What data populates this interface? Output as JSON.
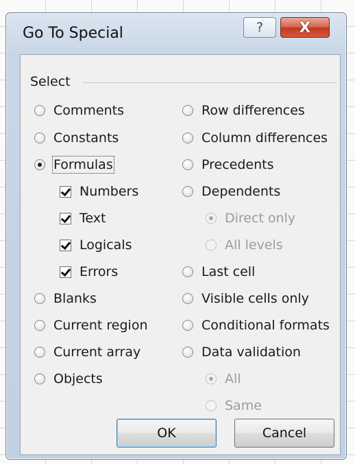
{
  "window": {
    "title": "Go To Special",
    "help_icon": "?",
    "close_icon": "X"
  },
  "group": {
    "label": "Select"
  },
  "left_options": [
    {
      "label": "Comments",
      "type": "radio",
      "selected": false,
      "enabled": true
    },
    {
      "label": "Constants",
      "type": "radio",
      "selected": false,
      "enabled": true
    },
    {
      "label": "Formulas",
      "type": "radio",
      "selected": true,
      "enabled": true
    },
    {
      "label": "Numbers",
      "type": "checkbox",
      "checked": true,
      "enabled": true
    },
    {
      "label": "Text",
      "type": "checkbox",
      "checked": true,
      "enabled": true
    },
    {
      "label": "Logicals",
      "type": "checkbox",
      "checked": true,
      "enabled": true
    },
    {
      "label": "Errors",
      "type": "checkbox",
      "checked": true,
      "enabled": true
    },
    {
      "label": "Blanks",
      "type": "radio",
      "selected": false,
      "enabled": true
    },
    {
      "label": "Current region",
      "type": "radio",
      "selected": false,
      "enabled": true
    },
    {
      "label": "Current array",
      "type": "radio",
      "selected": false,
      "enabled": true
    },
    {
      "label": "Objects",
      "type": "radio",
      "selected": false,
      "enabled": true
    }
  ],
  "right_options": [
    {
      "label": "Row differences",
      "type": "radio",
      "selected": false,
      "enabled": true
    },
    {
      "label": "Column differences",
      "type": "radio",
      "selected": false,
      "enabled": true
    },
    {
      "label": "Precedents",
      "type": "radio",
      "selected": false,
      "enabled": true
    },
    {
      "label": "Dependents",
      "type": "radio",
      "selected": false,
      "enabled": true
    },
    {
      "label": "Direct only",
      "type": "radio",
      "selected": true,
      "enabled": false
    },
    {
      "label": "All levels",
      "type": "radio",
      "selected": false,
      "enabled": false
    },
    {
      "label": "Last cell",
      "type": "radio",
      "selected": false,
      "enabled": true
    },
    {
      "label": "Visible cells only",
      "type": "radio",
      "selected": false,
      "enabled": true
    },
    {
      "label": "Conditional formats",
      "type": "radio",
      "selected": false,
      "enabled": true
    },
    {
      "label": "Data validation",
      "type": "radio",
      "selected": false,
      "enabled": true
    },
    {
      "label": "All",
      "type": "radio",
      "selected": true,
      "enabled": false
    },
    {
      "label": "Same",
      "type": "radio",
      "selected": false,
      "enabled": false
    }
  ],
  "buttons": {
    "ok": "OK",
    "cancel": "Cancel"
  }
}
